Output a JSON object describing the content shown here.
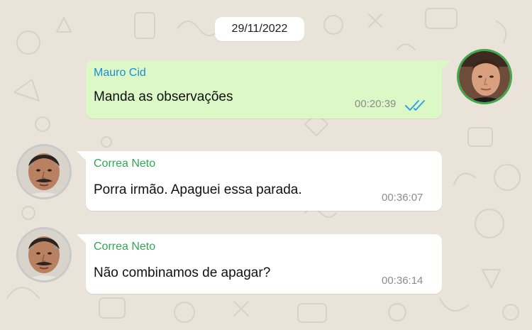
{
  "chat": {
    "date": "29/11/2022",
    "colors": {
      "background": "#e9e3da",
      "outgoing_bubble": "#dcf8c6",
      "incoming_bubble": "#ffffff",
      "outgoing_sender": "#1e8ad6",
      "incoming_sender": "#2fa856",
      "read_ticks": "#34a0e4"
    },
    "messages": [
      {
        "direction": "outgoing",
        "sender": "Mauro Cid",
        "text": "Manda as observações",
        "time": "00:20:39",
        "status_icon": "double-check-read-icon",
        "avatar_icon": "mauro-cid-avatar"
      },
      {
        "direction": "incoming",
        "sender": "Correa Neto",
        "text": "Porra irmão. Apaguei essa parada.",
        "time": "00:36:07",
        "avatar_icon": "correa-neto-avatar"
      },
      {
        "direction": "incoming",
        "sender": "Correa Neto",
        "text": "Não combinamos de apagar?",
        "time": "00:36:14",
        "avatar_icon": "correa-neto-avatar"
      }
    ]
  }
}
